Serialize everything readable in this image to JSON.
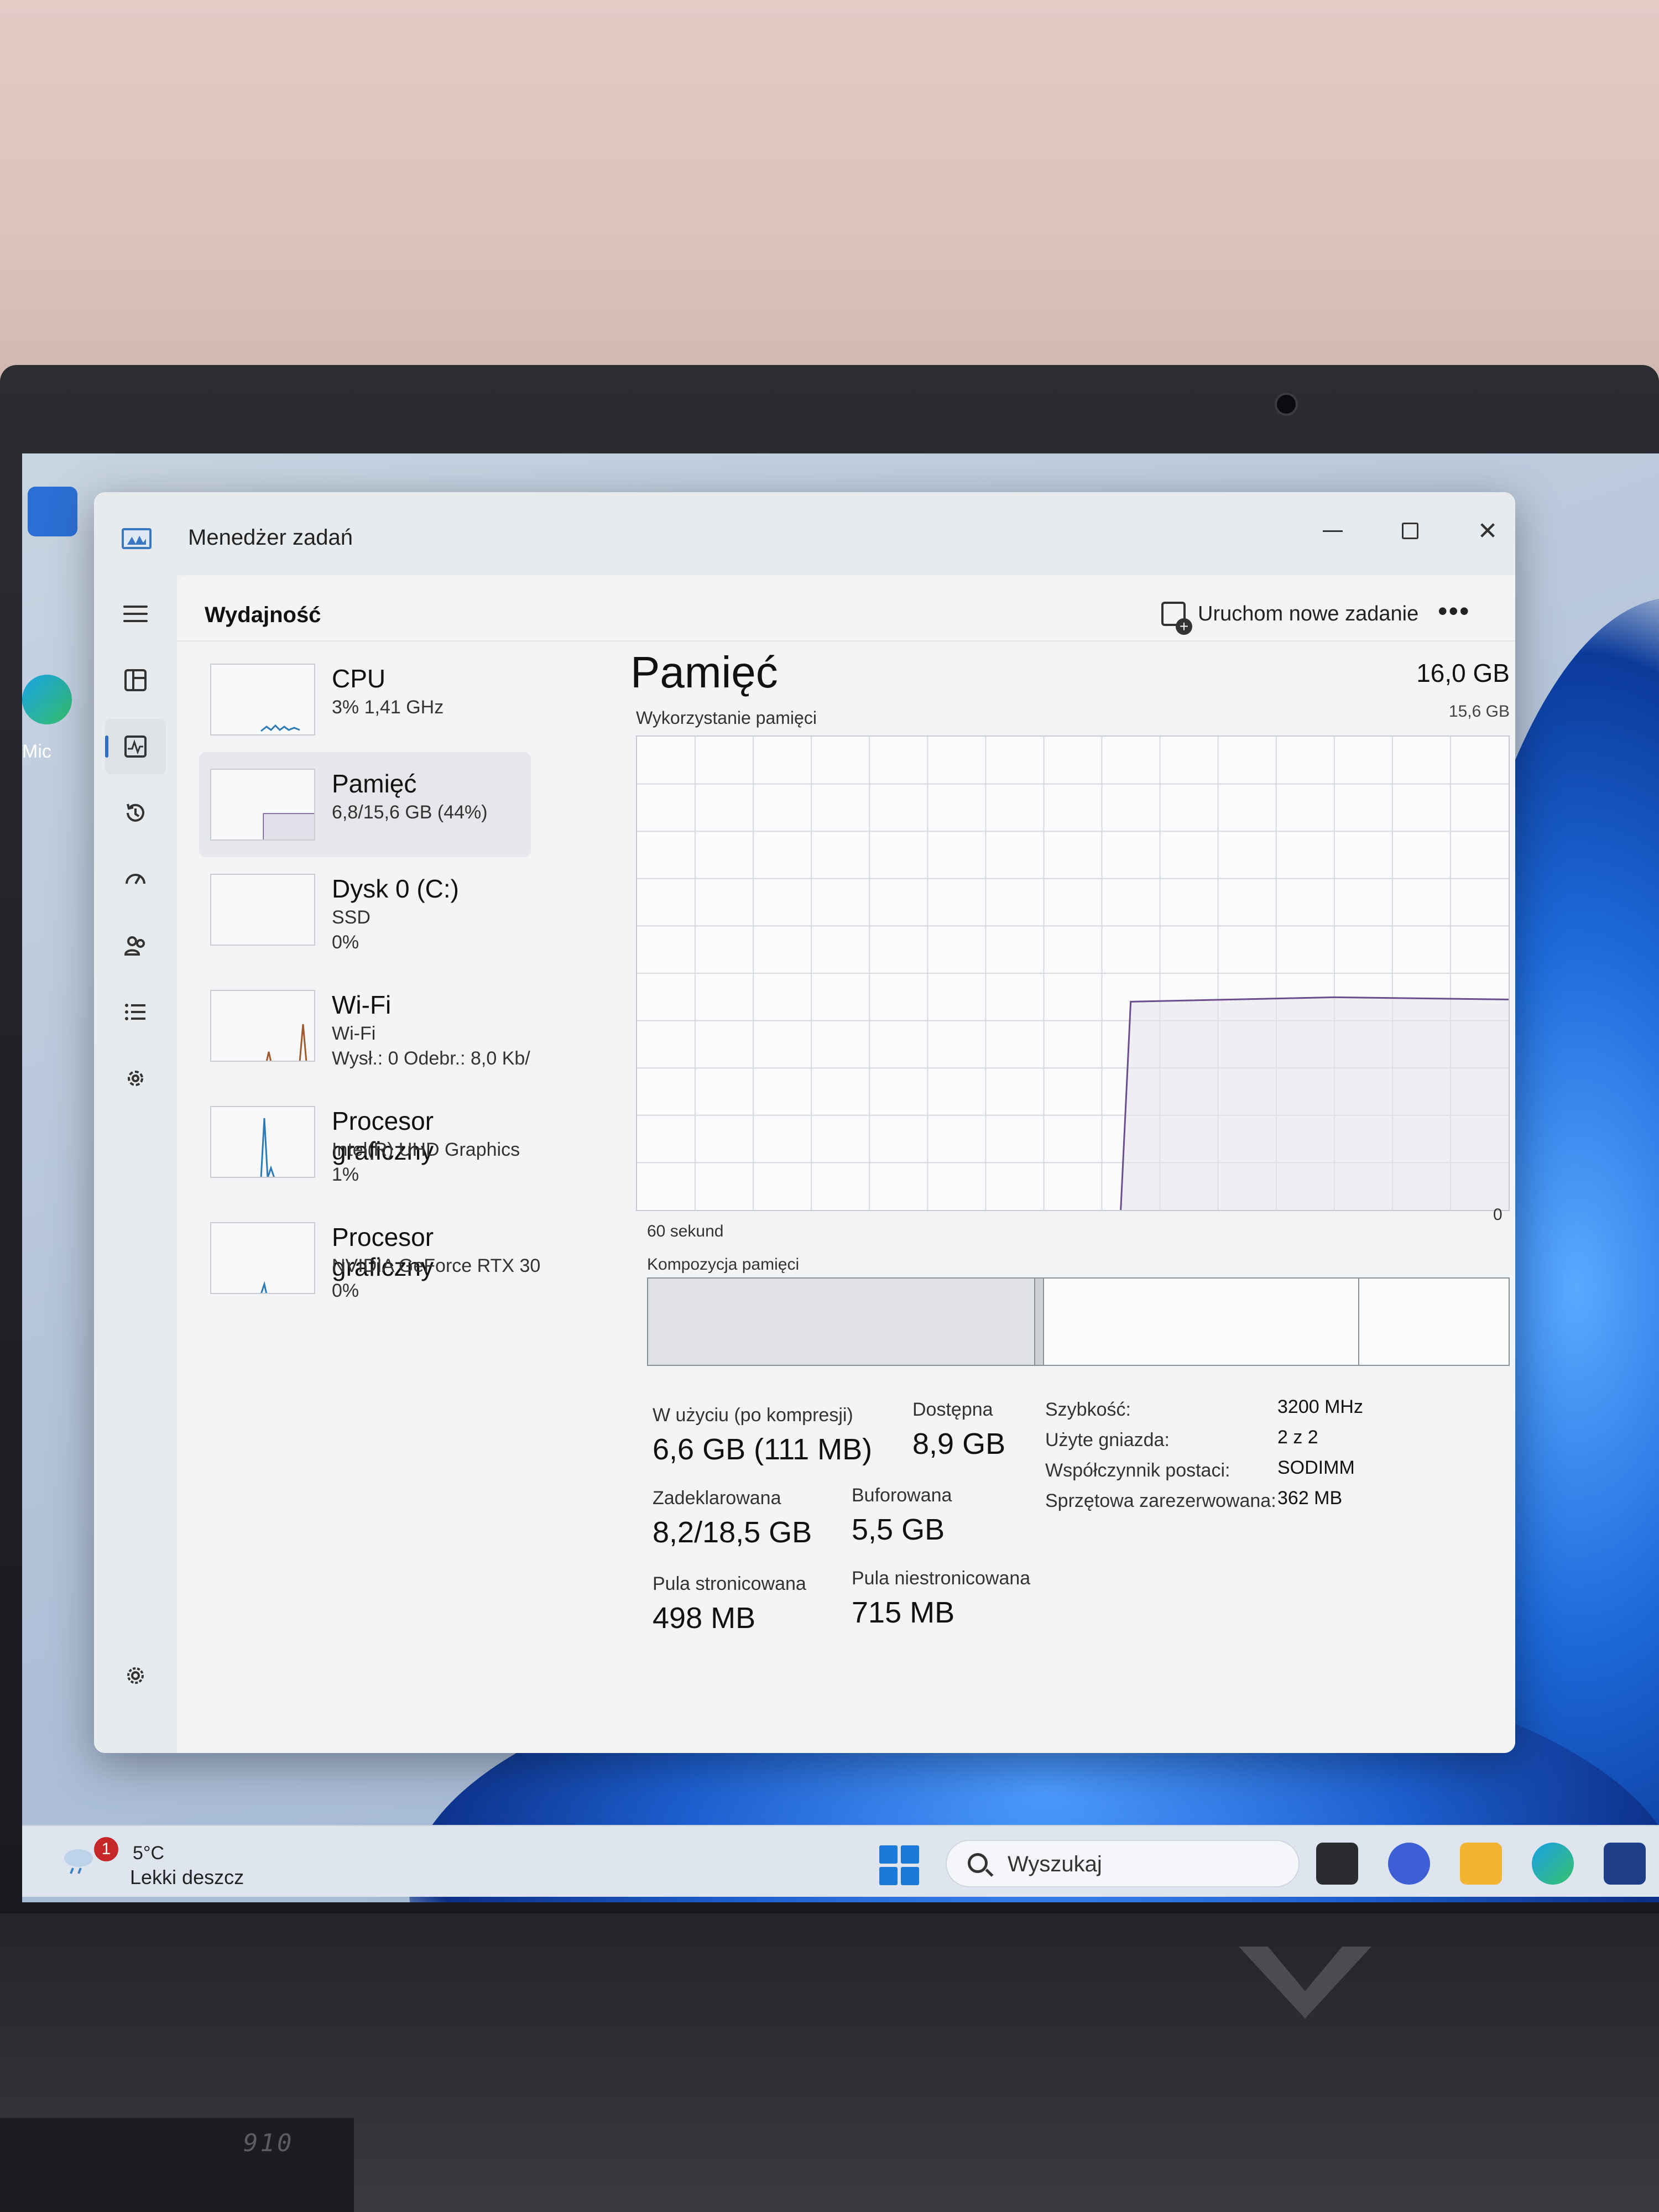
{
  "window": {
    "title": "Menedżer zadań",
    "page_title": "Wydajność",
    "new_task_label": "Uruchom nowe zadanie",
    "more_label": "•••",
    "controls": {
      "minimize": "",
      "maximize": "",
      "close": "✕"
    }
  },
  "nav": {
    "items": [
      {
        "icon": "hamburger-icon"
      },
      {
        "icon": "processes-icon"
      },
      {
        "icon": "performance-icon",
        "active": true
      },
      {
        "icon": "app-history-icon"
      },
      {
        "icon": "startup-apps-icon"
      },
      {
        "icon": "users-icon"
      },
      {
        "icon": "details-icon"
      },
      {
        "icon": "services-icon"
      },
      {
        "icon": "settings-icon"
      }
    ]
  },
  "devices": [
    {
      "name": "CPU",
      "sub1": "3% 1,41 GHz",
      "sub2": ""
    },
    {
      "name": "Pamięć",
      "sub1": "6,8/15,6 GB (44%)",
      "sub2": "",
      "active": true
    },
    {
      "name": "Dysk 0 (C:)",
      "sub1": "SSD",
      "sub2": "0%"
    },
    {
      "name": "Wi-Fi",
      "sub1": "Wi-Fi",
      "sub2": "Wysł.: 0 Odebr.: 8,0 Kb/"
    },
    {
      "name": "Procesor graficzny",
      "sub1": "Intel(R) UHD Graphics",
      "sub2": "1%"
    },
    {
      "name": "Procesor graficzny",
      "sub1": "NVIDIA GeForce RTX 30",
      "sub2": "0%"
    }
  ],
  "memory": {
    "title": "Pamięć",
    "total": "16,0 GB",
    "graph_max": "15,6 GB",
    "usage_label": "Wykorzystanie pamięci",
    "axis_left": "60 sekund",
    "axis_right": "0",
    "composition_label": "Kompozycja pamięci",
    "stats": {
      "in_use_label": "W użyciu (po kompresji)",
      "in_use_value": "6,6 GB (111 MB)",
      "available_label": "Dostępna",
      "available_value": "8,9 GB",
      "committed_label": "Zadeklarowana",
      "committed_value": "8,2/18,5 GB",
      "cached_label": "Buforowana",
      "cached_value": "5,5 GB",
      "paged_label": "Pula stronicowana",
      "paged_value": "498 MB",
      "nonpaged_label": "Pula niestronicowana",
      "nonpaged_value": "715 MB"
    },
    "specs": {
      "speed_label": "Szybkość:",
      "speed_value": "3200 MHz",
      "slots_label": "Użyte gniazda:",
      "slots_value": "2 z 2",
      "form_label": "Współczynnik postaci:",
      "form_value": "SODIMM",
      "reserved_label": "Sprzętowa zarezerwowana:",
      "reserved_value": "362 MB"
    }
  },
  "taskbar": {
    "weather_badge": "1",
    "weather_temp": "5°C",
    "weather_desc": "Lekki deszcz",
    "search_placeholder": "Wyszukaj"
  },
  "desktop": {
    "icon_label": "Mic"
  },
  "colors": {
    "accent": "#2f6cc8",
    "memory_line": "#6b4d8f",
    "graph_grid": "#d6d9dd"
  }
}
